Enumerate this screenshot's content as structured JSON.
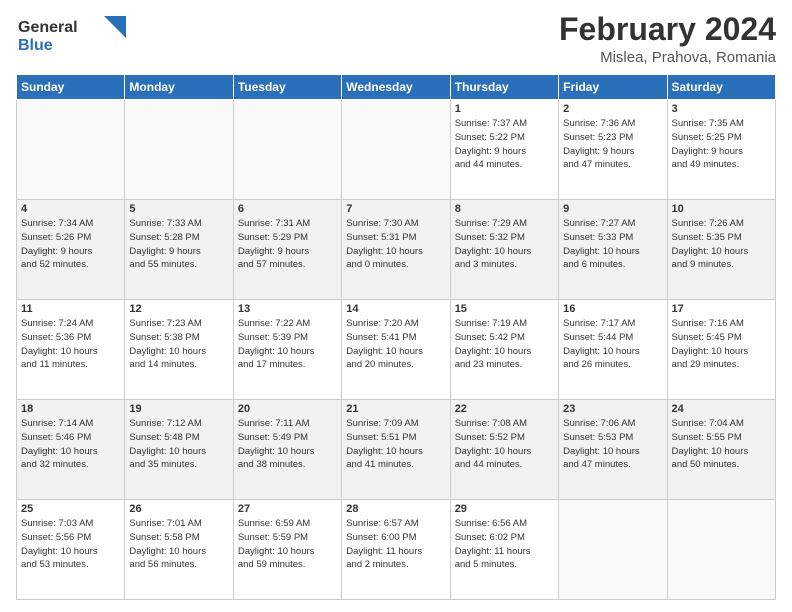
{
  "logo": {
    "line1": "General",
    "line2": "Blue"
  },
  "title": "February 2024",
  "subtitle": "Mislea, Prahova, Romania",
  "days_of_week": [
    "Sunday",
    "Monday",
    "Tuesday",
    "Wednesday",
    "Thursday",
    "Friday",
    "Saturday"
  ],
  "weeks": [
    [
      {
        "day": "",
        "info": ""
      },
      {
        "day": "",
        "info": ""
      },
      {
        "day": "",
        "info": ""
      },
      {
        "day": "",
        "info": ""
      },
      {
        "day": "1",
        "info": "Sunrise: 7:37 AM\nSunset: 5:22 PM\nDaylight: 9 hours\nand 44 minutes."
      },
      {
        "day": "2",
        "info": "Sunrise: 7:36 AM\nSunset: 5:23 PM\nDaylight: 9 hours\nand 47 minutes."
      },
      {
        "day": "3",
        "info": "Sunrise: 7:35 AM\nSunset: 5:25 PM\nDaylight: 9 hours\nand 49 minutes."
      }
    ],
    [
      {
        "day": "4",
        "info": "Sunrise: 7:34 AM\nSunset: 5:26 PM\nDaylight: 9 hours\nand 52 minutes."
      },
      {
        "day": "5",
        "info": "Sunrise: 7:33 AM\nSunset: 5:28 PM\nDaylight: 9 hours\nand 55 minutes."
      },
      {
        "day": "6",
        "info": "Sunrise: 7:31 AM\nSunset: 5:29 PM\nDaylight: 9 hours\nand 57 minutes."
      },
      {
        "day": "7",
        "info": "Sunrise: 7:30 AM\nSunset: 5:31 PM\nDaylight: 10 hours\nand 0 minutes."
      },
      {
        "day": "8",
        "info": "Sunrise: 7:29 AM\nSunset: 5:32 PM\nDaylight: 10 hours\nand 3 minutes."
      },
      {
        "day": "9",
        "info": "Sunrise: 7:27 AM\nSunset: 5:33 PM\nDaylight: 10 hours\nand 6 minutes."
      },
      {
        "day": "10",
        "info": "Sunrise: 7:26 AM\nSunset: 5:35 PM\nDaylight: 10 hours\nand 9 minutes."
      }
    ],
    [
      {
        "day": "11",
        "info": "Sunrise: 7:24 AM\nSunset: 5:36 PM\nDaylight: 10 hours\nand 11 minutes."
      },
      {
        "day": "12",
        "info": "Sunrise: 7:23 AM\nSunset: 5:38 PM\nDaylight: 10 hours\nand 14 minutes."
      },
      {
        "day": "13",
        "info": "Sunrise: 7:22 AM\nSunset: 5:39 PM\nDaylight: 10 hours\nand 17 minutes."
      },
      {
        "day": "14",
        "info": "Sunrise: 7:20 AM\nSunset: 5:41 PM\nDaylight: 10 hours\nand 20 minutes."
      },
      {
        "day": "15",
        "info": "Sunrise: 7:19 AM\nSunset: 5:42 PM\nDaylight: 10 hours\nand 23 minutes."
      },
      {
        "day": "16",
        "info": "Sunrise: 7:17 AM\nSunset: 5:44 PM\nDaylight: 10 hours\nand 26 minutes."
      },
      {
        "day": "17",
        "info": "Sunrise: 7:16 AM\nSunset: 5:45 PM\nDaylight: 10 hours\nand 29 minutes."
      }
    ],
    [
      {
        "day": "18",
        "info": "Sunrise: 7:14 AM\nSunset: 5:46 PM\nDaylight: 10 hours\nand 32 minutes."
      },
      {
        "day": "19",
        "info": "Sunrise: 7:12 AM\nSunset: 5:48 PM\nDaylight: 10 hours\nand 35 minutes."
      },
      {
        "day": "20",
        "info": "Sunrise: 7:11 AM\nSunset: 5:49 PM\nDaylight: 10 hours\nand 38 minutes."
      },
      {
        "day": "21",
        "info": "Sunrise: 7:09 AM\nSunset: 5:51 PM\nDaylight: 10 hours\nand 41 minutes."
      },
      {
        "day": "22",
        "info": "Sunrise: 7:08 AM\nSunset: 5:52 PM\nDaylight: 10 hours\nand 44 minutes."
      },
      {
        "day": "23",
        "info": "Sunrise: 7:06 AM\nSunset: 5:53 PM\nDaylight: 10 hours\nand 47 minutes."
      },
      {
        "day": "24",
        "info": "Sunrise: 7:04 AM\nSunset: 5:55 PM\nDaylight: 10 hours\nand 50 minutes."
      }
    ],
    [
      {
        "day": "25",
        "info": "Sunrise: 7:03 AM\nSunset: 5:56 PM\nDaylight: 10 hours\nand 53 minutes."
      },
      {
        "day": "26",
        "info": "Sunrise: 7:01 AM\nSunset: 5:58 PM\nDaylight: 10 hours\nand 56 minutes."
      },
      {
        "day": "27",
        "info": "Sunrise: 6:59 AM\nSunset: 5:59 PM\nDaylight: 10 hours\nand 59 minutes."
      },
      {
        "day": "28",
        "info": "Sunrise: 6:57 AM\nSunset: 6:00 PM\nDaylight: 11 hours\nand 2 minutes."
      },
      {
        "day": "29",
        "info": "Sunrise: 6:56 AM\nSunset: 6:02 PM\nDaylight: 11 hours\nand 5 minutes."
      },
      {
        "day": "",
        "info": ""
      },
      {
        "day": "",
        "info": ""
      }
    ]
  ]
}
